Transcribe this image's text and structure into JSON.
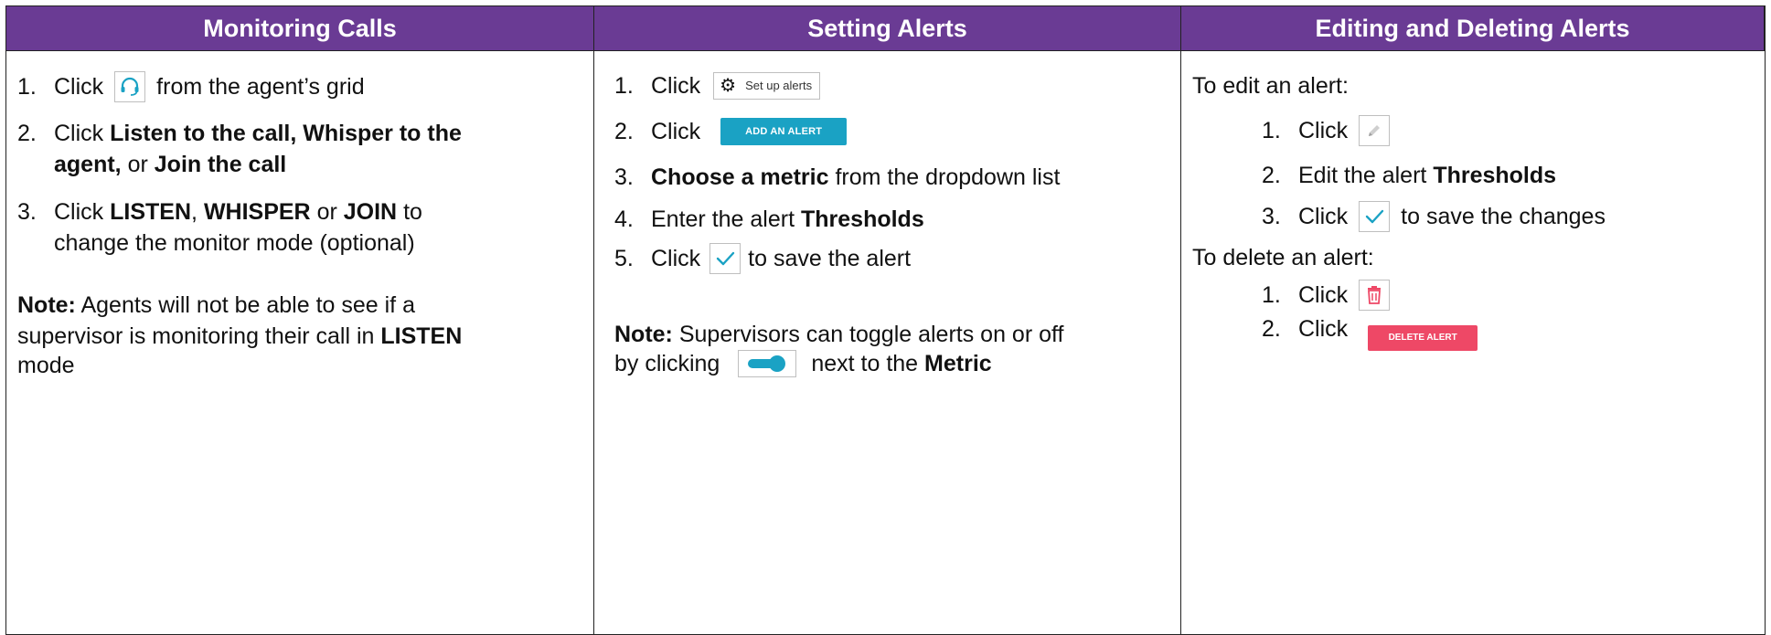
{
  "headers": [
    "Monitoring Calls",
    "Setting Alerts",
    "Editing and Deleting Alerts"
  ],
  "col1": {
    "s1": {
      "num": "1.",
      "a": "Click",
      "b": "from the agent’s grid"
    },
    "s2": {
      "num": "2.",
      "a": "Click",
      "b1": "Listen to the call, Whisper to the",
      "b2": "agent,",
      "c": "or",
      "d": "Join the call"
    },
    "s3": {
      "num": "3.",
      "a": "Click",
      "b": "LISTEN",
      "c": ",",
      "d": "WHISPER",
      "e": "or",
      "f": "JOIN",
      "g": "to",
      "h": "change the monitor mode (optional)"
    },
    "note": {
      "label": "Note:",
      "l1": "Agents will not be able to see if a",
      "l2": "supervisor is monitoring their call in",
      "bold": "LISTEN",
      "l3": "mode"
    }
  },
  "col2": {
    "s1": {
      "num": "1.",
      "a": "Click",
      "btn": "Set up alerts"
    },
    "s2": {
      "num": "2.",
      "a": "Click",
      "btn": "ADD AN ALERT"
    },
    "s3": {
      "num": "3.",
      "b": "Choose a metric",
      "c": "from the dropdown list"
    },
    "s4": {
      "num": "4.",
      "a": "Enter the alert",
      "b": "Thresholds"
    },
    "s5": {
      "num": "5.",
      "a": "Click",
      "b": "to save the alert"
    },
    "note": {
      "label": "Note:",
      "l1": "Supervisors can toggle alerts on or off",
      "l2a": "by clicking",
      "l2b": "next to the",
      "bold": "Metric"
    }
  },
  "col3": {
    "edit_title": "To edit an alert:",
    "e1": {
      "num": "1.",
      "a": "Click"
    },
    "e2": {
      "num": "2.",
      "a": "Edit the alert",
      "b": "Thresholds"
    },
    "e3": {
      "num": "3.",
      "a": "Click",
      "b": "to save the changes"
    },
    "delete_title": "To delete an alert:",
    "d1": {
      "num": "1.",
      "a": "Click"
    },
    "d2": {
      "num": "2.",
      "a": "Click",
      "btn": "DELETE ALERT"
    }
  },
  "colors": {
    "header": "#6a3b94",
    "add_button": "#1aa2c4",
    "delete_button": "#ee4866",
    "check": "#1aa2c4",
    "headset": "#1aa2c4",
    "trash": "#ee4866"
  }
}
